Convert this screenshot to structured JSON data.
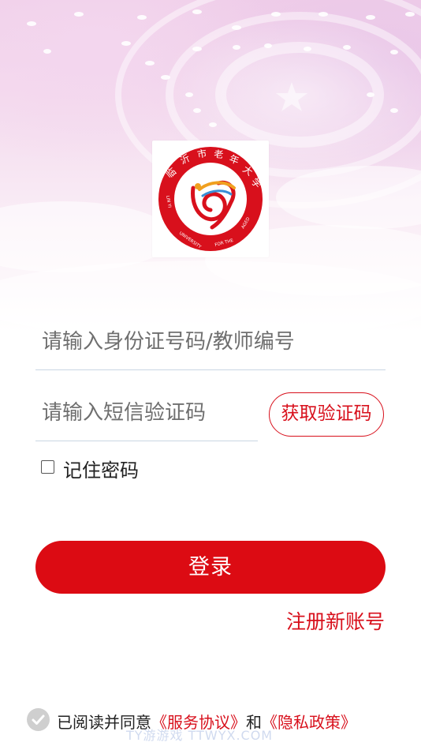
{
  "logo": {
    "seal_text": "临沂市老年大学",
    "english_ring": "LIN YI UNIVERSITY FOR THE AGED",
    "colors": {
      "ring": "#d8101c",
      "accent": "#f0a020"
    }
  },
  "form": {
    "id_placeholder": "请输入身份证号码/教师编号",
    "sms_placeholder": "请输入短信验证码",
    "get_code_label": "获取验证码",
    "remember_label": "记住密码",
    "remember_checked": false
  },
  "actions": {
    "login_label": "登录",
    "register_label": "注册新账号"
  },
  "agreement": {
    "prefix": "已阅读并同意",
    "service_link": "《服务协议》",
    "conjunction": "和",
    "privacy_link": "《隐私政策》",
    "check_icon": "check-circle-icon"
  },
  "watermark": "TY游游戏 TTWYX.COM",
  "theme": {
    "primary": "#dc0b13",
    "link": "#d8101c",
    "hero_tint": "#f1cfe9"
  }
}
